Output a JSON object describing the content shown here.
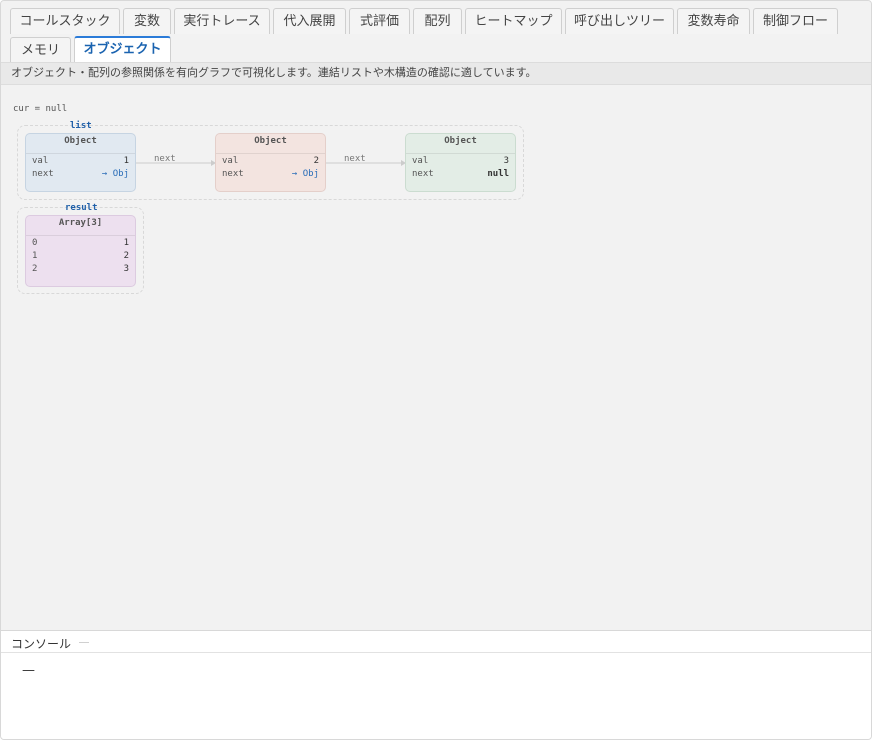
{
  "tabs": [
    {
      "label": "コールスタック"
    },
    {
      "label": "変数"
    },
    {
      "label": "実行トレース"
    },
    {
      "label": "代入展開"
    },
    {
      "label": "式評価"
    },
    {
      "label": "配列"
    },
    {
      "label": "ヒートマップ"
    },
    {
      "label": "呼び出しツリー"
    },
    {
      "label": "変数寿命"
    },
    {
      "label": "制御フロー"
    },
    {
      "label": "メモリ"
    },
    {
      "label": "オブジェクト"
    }
  ],
  "active_tab": "オブジェクト",
  "description": "オブジェクト・配列の参照関係を有向グラフで可視化します。連結リストや木構造の確認に適しています。",
  "graph": {
    "cur_line": "cur = null",
    "groups": [
      {
        "label": "list"
      },
      {
        "label": "result"
      }
    ],
    "nodes": [
      {
        "title": "Object",
        "color": "#e1e9f1",
        "border": "#c6d4e2",
        "rows": [
          {
            "k": "val",
            "v": "1"
          },
          {
            "k": "next",
            "v": "→ Obj"
          }
        ]
      },
      {
        "title": "Object",
        "color": "#f3e4e0",
        "border": "#e4cfca",
        "rows": [
          {
            "k": "val",
            "v": "2"
          },
          {
            "k": "next",
            "v": "→ Obj"
          }
        ]
      },
      {
        "title": "Object",
        "color": "#e3ede6",
        "border": "#cbdcd0",
        "rows": [
          {
            "k": "val",
            "v": "3"
          },
          {
            "k": "next",
            "v": "null"
          }
        ]
      },
      {
        "title": "Array[3]",
        "color": "#ede0ef",
        "border": "#dccbe0",
        "rows": [
          {
            "k": "0",
            "v": "1"
          },
          {
            "k": "1",
            "v": "2"
          },
          {
            "k": "2",
            "v": "3"
          }
        ]
      }
    ],
    "edges": [
      {
        "label": "next"
      },
      {
        "label": "next"
      }
    ]
  },
  "console": {
    "title": "コンソール",
    "empty_text": "—"
  }
}
